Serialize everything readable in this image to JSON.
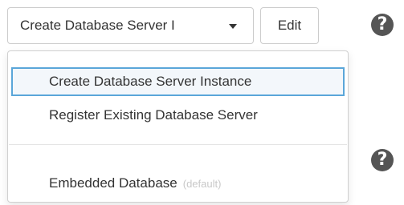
{
  "select": {
    "value": "Create Database Server I"
  },
  "edit_button": {
    "label": "Edit"
  },
  "help_icon": {
    "glyph": "?",
    "icon": "question-circle-icon",
    "color": "#555555"
  },
  "dropdown": {
    "items": [
      {
        "label": "Create Database Server Instance",
        "selected": true
      },
      {
        "label": "Register Existing Database Server",
        "selected": false
      },
      {
        "label": "Embedded Database",
        "tag": "(default)",
        "selected": false
      }
    ]
  },
  "colors": {
    "focus_border": "#5aa6d9",
    "text": "#333333",
    "muted": "#c8c8c8"
  }
}
